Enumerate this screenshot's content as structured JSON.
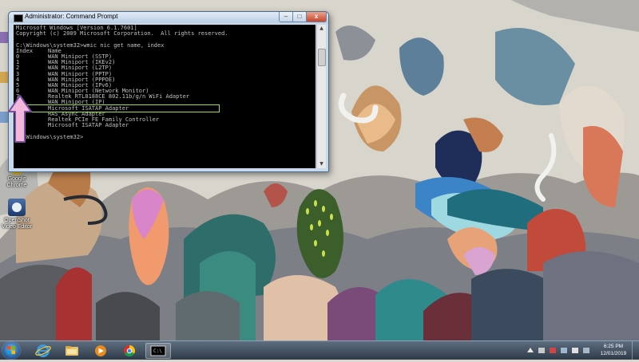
{
  "window": {
    "title": "Administrator: Command Prompt",
    "min_label": "–",
    "max_label": "□",
    "close_label": "x"
  },
  "console": {
    "header_lines": [
      "Microsoft Windows [Version 6.1.7601]",
      "Copyright (c) 2009 Microsoft Corporation.  All rights reserved.",
      "",
      "C:\\Windows\\system32>wmic nic get name, index"
    ],
    "column_headers": [
      "Index",
      "Name"
    ],
    "rows": [
      {
        "index": "0",
        "name": "WAN Miniport (SSTP)"
      },
      {
        "index": "1",
        "name": "WAN Miniport (IKEv2)"
      },
      {
        "index": "2",
        "name": "WAN Miniport (L2TP)"
      },
      {
        "index": "3",
        "name": "WAN Miniport (PPTP)"
      },
      {
        "index": "4",
        "name": "WAN Miniport (PPPOE)"
      },
      {
        "index": "5",
        "name": "WAN Miniport (IPv6)"
      },
      {
        "index": "6",
        "name": "WAN Miniport (Network Monitor)"
      },
      {
        "index": "7",
        "name": "Realtek RTL8188CE 802.11b/g/n WiFi Adapter"
      },
      {
        "index": "",
        "name": "WAN Miniport (IP)"
      },
      {
        "index": "",
        "name": "Microsoft ISATAP Adapter"
      },
      {
        "index": "",
        "name": "RAS Async Adapter"
      },
      {
        "index": "",
        "name": "Realtek PCIe FE Family Controller"
      },
      {
        "index": "",
        "name": "Microsoft ISATAP Adapter"
      }
    ],
    "highlighted_row_index": 7,
    "prompt": "C:\\Windows\\system32>"
  },
  "desktop_icons": [
    {
      "name": "Google Chrome",
      "icon": "chrome-icon"
    },
    {
      "name": "OpenShot Video Editor",
      "icon": "openshot-icon"
    }
  ],
  "taskbar": {
    "items": [
      "start-orb",
      "internet-explorer-icon",
      "file-explorer-icon",
      "media-player-icon",
      "chrome-icon",
      "command-prompt-icon"
    ],
    "clock_time": "6:25 PM",
    "clock_date": "12/01/2019"
  },
  "colors": {
    "highlight": "#9fe04a",
    "arrow_fill": "#f2b8dc",
    "console_bg": "#000000",
    "console_text": "#c0c0c0"
  }
}
